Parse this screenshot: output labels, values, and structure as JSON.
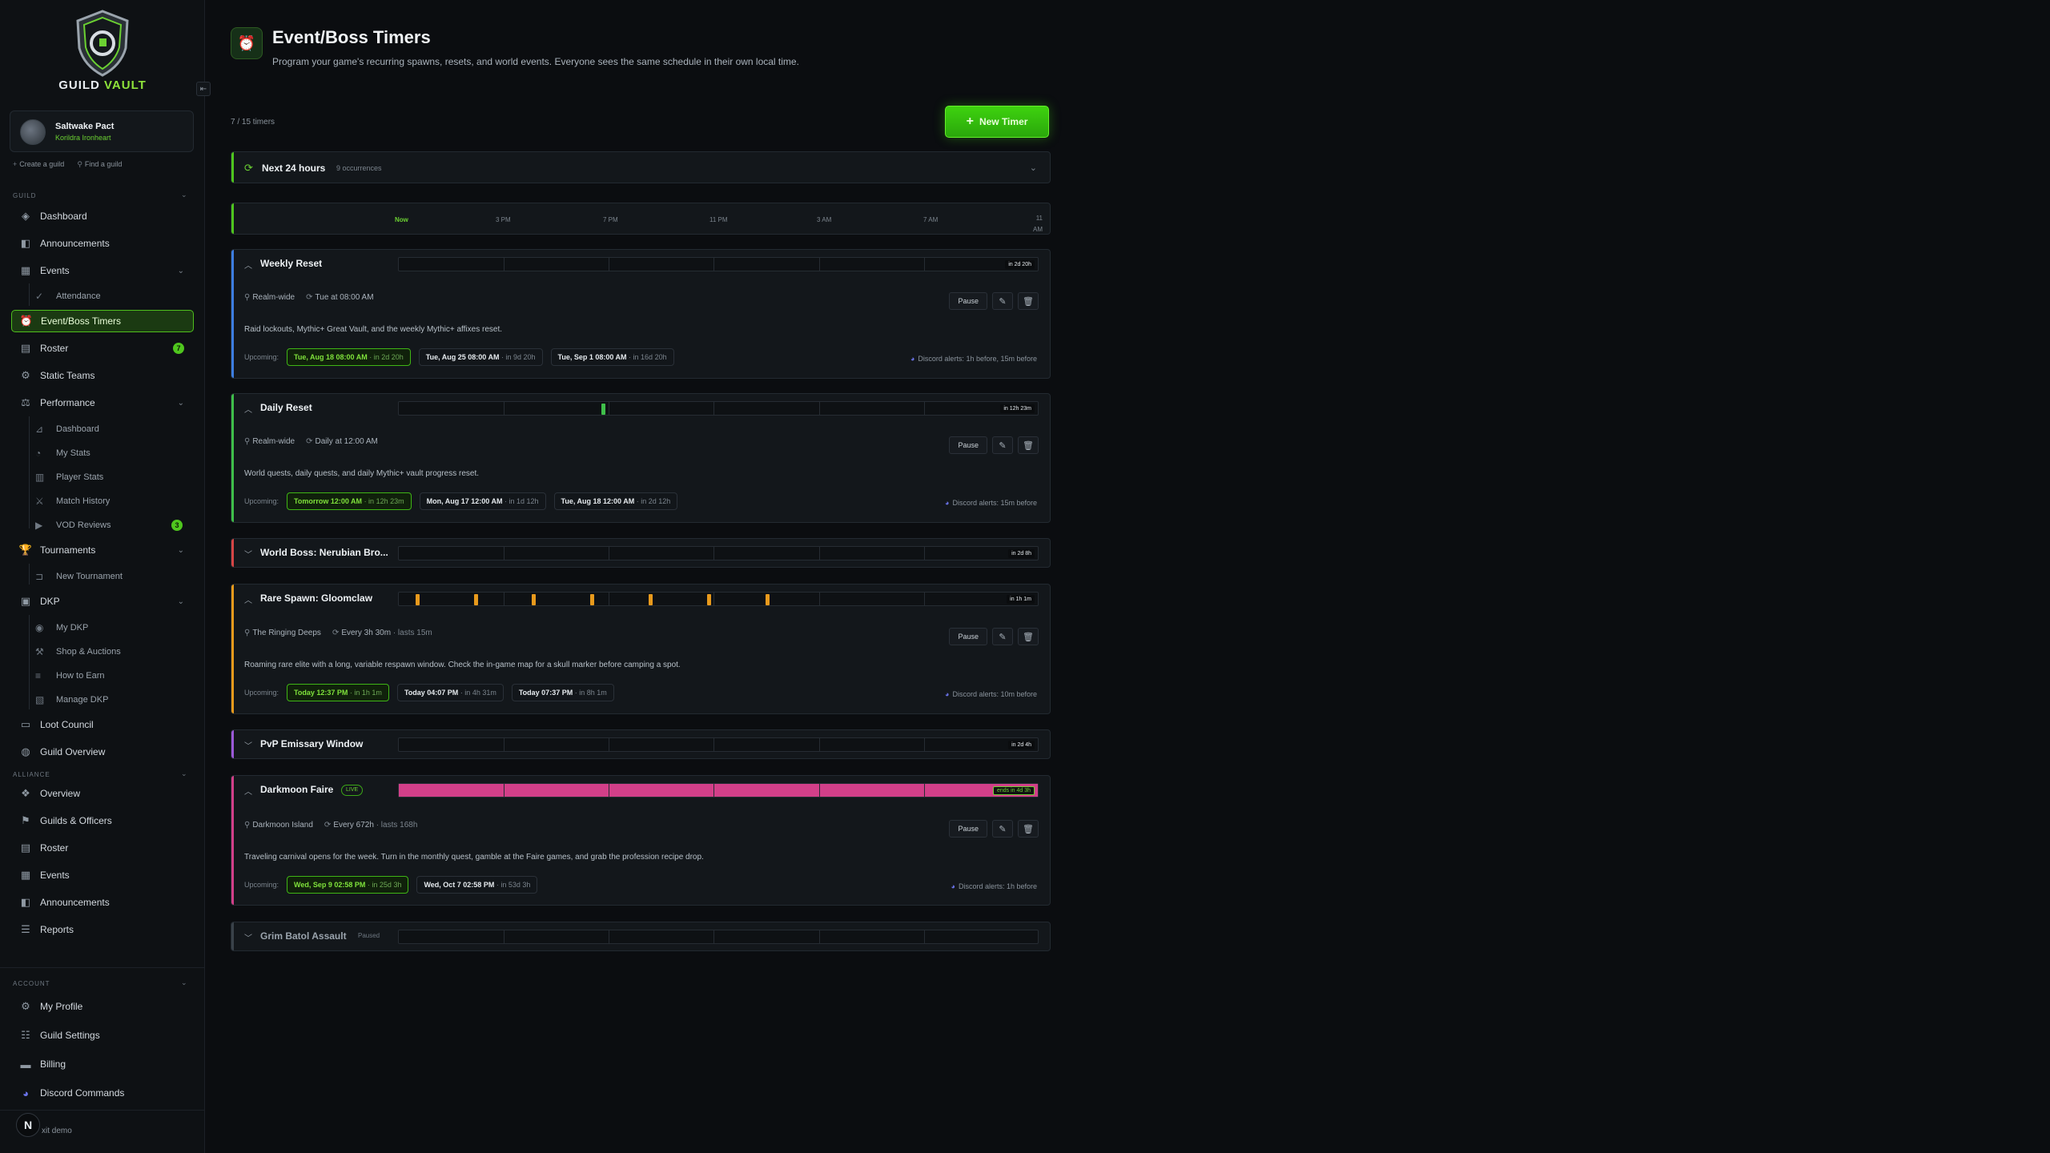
{
  "brand": {
    "name_part1": "GUILD",
    "name_part2": "VAULT"
  },
  "guild": {
    "name": "Saltwake Pact",
    "subtitle": "Korildra Ironheart"
  },
  "guild_links": {
    "create": "Create a guild",
    "find": "Find a guild"
  },
  "sections": {
    "guild": "GUILD",
    "alliance": "ALLIANCE",
    "account": "ACCOUNT"
  },
  "nav": {
    "dashboard": "Dashboard",
    "announcements": "Announcements",
    "events": "Events",
    "attendance": "Attendance",
    "event_boss_timers": "Event/Boss Timers",
    "roster": "Roster",
    "roster_badge": "7",
    "static_teams": "Static Teams",
    "performance": "Performance",
    "perf_dashboard": "Dashboard",
    "my_stats": "My Stats",
    "player_stats": "Player Stats",
    "match_history": "Match History",
    "vod_reviews": "VOD Reviews",
    "vod_badge": "3",
    "tournaments": "Tournaments",
    "new_tournament": "New Tournament",
    "dkp": "DKP",
    "my_dkp": "My DKP",
    "shop_auctions": "Shop & Auctions",
    "how_to_earn": "How to Earn",
    "manage_dkp": "Manage DKP",
    "loot_council": "Loot Council",
    "guild_overview": "Guild Overview",
    "alliance_overview": "Overview",
    "guilds_officers": "Guilds & Officers",
    "alliance_roster": "Roster",
    "alliance_events": "Events",
    "alliance_announcements": "Announcements",
    "reports": "Reports",
    "my_profile": "My Profile",
    "guild_settings": "Guild Settings",
    "billing": "Billing",
    "discord_commands": "Discord Commands"
  },
  "user": {
    "initial": "N",
    "label": "xit demo"
  },
  "page": {
    "title": "Event/Boss Timers",
    "description": "Program your game's recurring spawns, resets, and world events. Everyone sees the same schedule in their own local time.",
    "count": "7 / 15 timers",
    "new_timer": "New Timer"
  },
  "next24": {
    "title": "Next 24 hours",
    "occurrences": "9 occurrences"
  },
  "axis_ticks": [
    "Now",
    "3 PM",
    "7 PM",
    "11 PM",
    "3 AM",
    "7 AM",
    "11 AM"
  ],
  "labels": {
    "upcoming": "Upcoming:",
    "pause": "Pause"
  },
  "colors": {
    "accent": "#4fc61e",
    "weekly": "#3d7de0",
    "daily": "#3fbf4a",
    "worldboss": "#d64545",
    "rare": "#e89a1c",
    "pvp": "#9b59d8",
    "faire": "#d23f89",
    "paused": "#3a424a"
  },
  "timers": [
    {
      "name": "Weekly Reset",
      "eta": "in 2d 20h",
      "location": "Realm-wide",
      "schedule": "Tue at 08:00 AM",
      "duration": "",
      "description": "Raid lockouts, Mythic+ Great Vault, and the weekly Mythic+ affixes reset.",
      "upcoming": [
        {
          "when": "Tue, Aug 18 08:00 AM",
          "rel": "· in 2d 20h"
        },
        {
          "when": "Tue, Aug 25 08:00 AM",
          "rel": "· in 9d 20h"
        },
        {
          "when": "Tue, Sep 1 08:00 AM",
          "rel": "· in 16d 20h"
        }
      ],
      "alerts": "Discord alerts: 1h before, 15m before"
    },
    {
      "name": "Daily Reset",
      "eta": "in 12h 23m",
      "location": "Realm-wide",
      "schedule": "Daily at 12:00 AM",
      "duration": "",
      "description": "World quests, daily quests, and daily Mythic+ vault progress reset.",
      "upcoming": [
        {
          "when": "Tomorrow 12:00 AM",
          "rel": "· in 12h 23m"
        },
        {
          "when": "Mon, Aug 17 12:00 AM",
          "rel": "· in 1d 12h"
        },
        {
          "when": "Tue, Aug 18 12:00 AM",
          "rel": "· in 2d 12h"
        }
      ],
      "alerts": "Discord alerts: 15m before"
    },
    {
      "name": "World Boss: Nerubian Bro...",
      "eta": "in 2d 8h"
    },
    {
      "name": "Rare Spawn: Gloomclaw",
      "eta": "in 1h 1m",
      "location": "The Ringing Deeps",
      "schedule": "Every 3h 30m",
      "duration": "· lasts 15m",
      "description": "Roaming rare elite with a long, variable respawn window. Check the in-game map for a skull marker before camping a spot.",
      "upcoming": [
        {
          "when": "Today 12:37 PM",
          "rel": "· in 1h 1m"
        },
        {
          "when": "Today 04:07 PM",
          "rel": "· in 4h 31m"
        },
        {
          "when": "Today 07:37 PM",
          "rel": "· in 8h 1m"
        }
      ],
      "alerts": "Discord alerts: 10m before"
    },
    {
      "name": "PvP Emissary Window",
      "eta": "in 2d 4h"
    },
    {
      "name": "Darkmoon Faire",
      "live": "LIVE",
      "eta": "ends in 4d 3h",
      "location": "Darkmoon Island",
      "schedule": "Every 672h",
      "duration": "· lasts 168h",
      "description": "Traveling carnival opens for the week. Turn in the monthly quest, gamble at the Faire games, and grab the profession recipe drop.",
      "upcoming": [
        {
          "when": "Wed, Sep 9 02:58 PM",
          "rel": "· in 25d 3h"
        },
        {
          "when": "Wed, Oct 7 02:58 PM",
          "rel": "· in 53d 3h"
        }
      ],
      "alerts": "Discord alerts: 1h before"
    },
    {
      "name": "Grim Batol Assault",
      "status": "Paused"
    }
  ]
}
